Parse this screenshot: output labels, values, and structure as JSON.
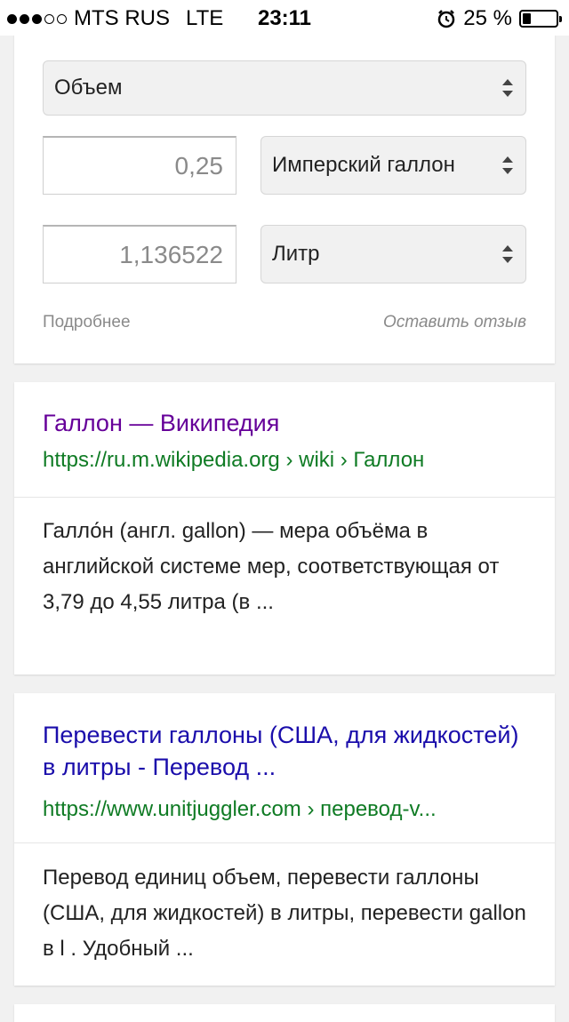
{
  "status_bar": {
    "carrier": "MTS RUS",
    "network": "LTE",
    "time": "23:11",
    "battery": "25 %",
    "signal_bars": 3,
    "signal_total": 5,
    "battery_level": 0.25
  },
  "converter": {
    "category": "Объем",
    "from_value": "0,25",
    "from_unit": "Имперский галлон",
    "to_value": "1,136522",
    "to_unit": "Литр",
    "more_link": "Подробнее",
    "feedback_link": "Оставить отзыв"
  },
  "results": [
    {
      "title": "Галлон — Википедия",
      "url": "https://ru.m.wikipedia.org › wiki › Галлон",
      "snippet": "Галло́н (англ. gallon) — мера объёма в английской системе мер, соответствующая от 3,79 до 4,55 литра (в ...",
      "title_color": "#660099"
    },
    {
      "title": "Перевести галлоны (США, для жидкостей) в литры - Перевод ...",
      "url": "https://www.unitjuggler.com › перевод-v...",
      "snippet": "Перевод единиц объем, перевести галлоны (США, для жидкостей) в литры, перевести gallon в l . Удобный  ...",
      "title_color": "#1a0dab"
    }
  ],
  "colors": {
    "url_green": "#0f7b24",
    "background": "#f1f1f1"
  }
}
